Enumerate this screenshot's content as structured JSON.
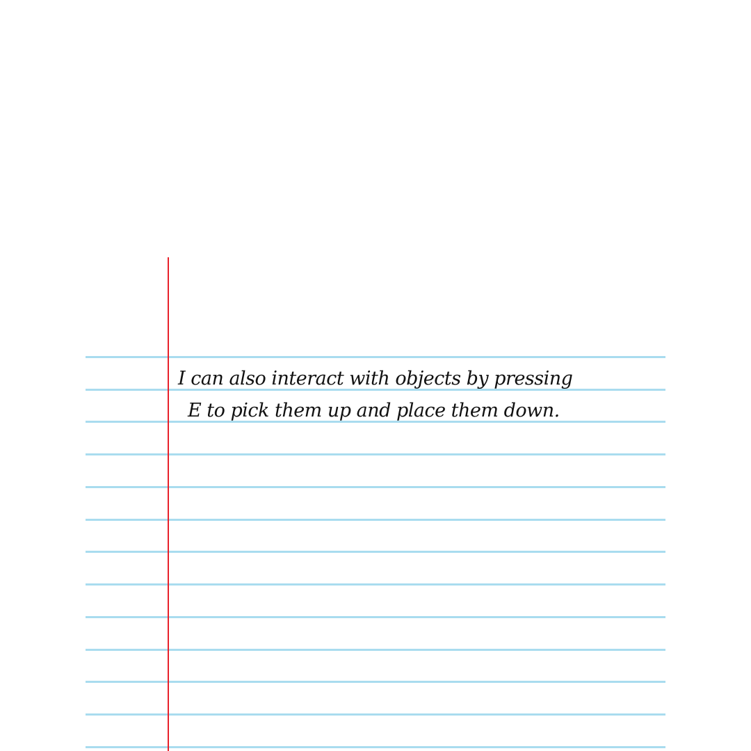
{
  "notebook": {
    "lines": [
      "I can also interact with objects by pressing",
      "E to pick them up and place them down."
    ]
  },
  "colors": {
    "rule_line": "#a9dcef",
    "margin_line": "#e8202a",
    "ink": "#111111",
    "paper": "#ffffff"
  }
}
